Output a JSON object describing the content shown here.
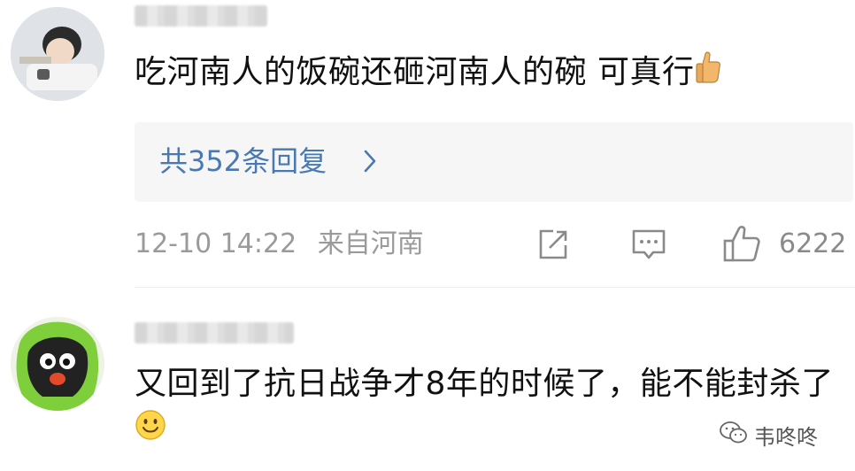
{
  "comments": [
    {
      "text": "吃河南人的饭碗还砸河南人的碗  可真行",
      "emoji": "thumbs-up",
      "replies_label": "共352条回复",
      "timestamp": "12-10 14:22",
      "location": "来自河南",
      "likes": "6222"
    },
    {
      "text": "又回到了抗日战争才8年的时候了，能不能封杀了",
      "emoji": "smile"
    }
  ],
  "watermark": {
    "text": "韦咚咚",
    "icon": "wechat-icon"
  },
  "colors": {
    "link": "#4a78b0",
    "meta": "#9a9a9a",
    "reply_bg": "#f6f6f6"
  }
}
